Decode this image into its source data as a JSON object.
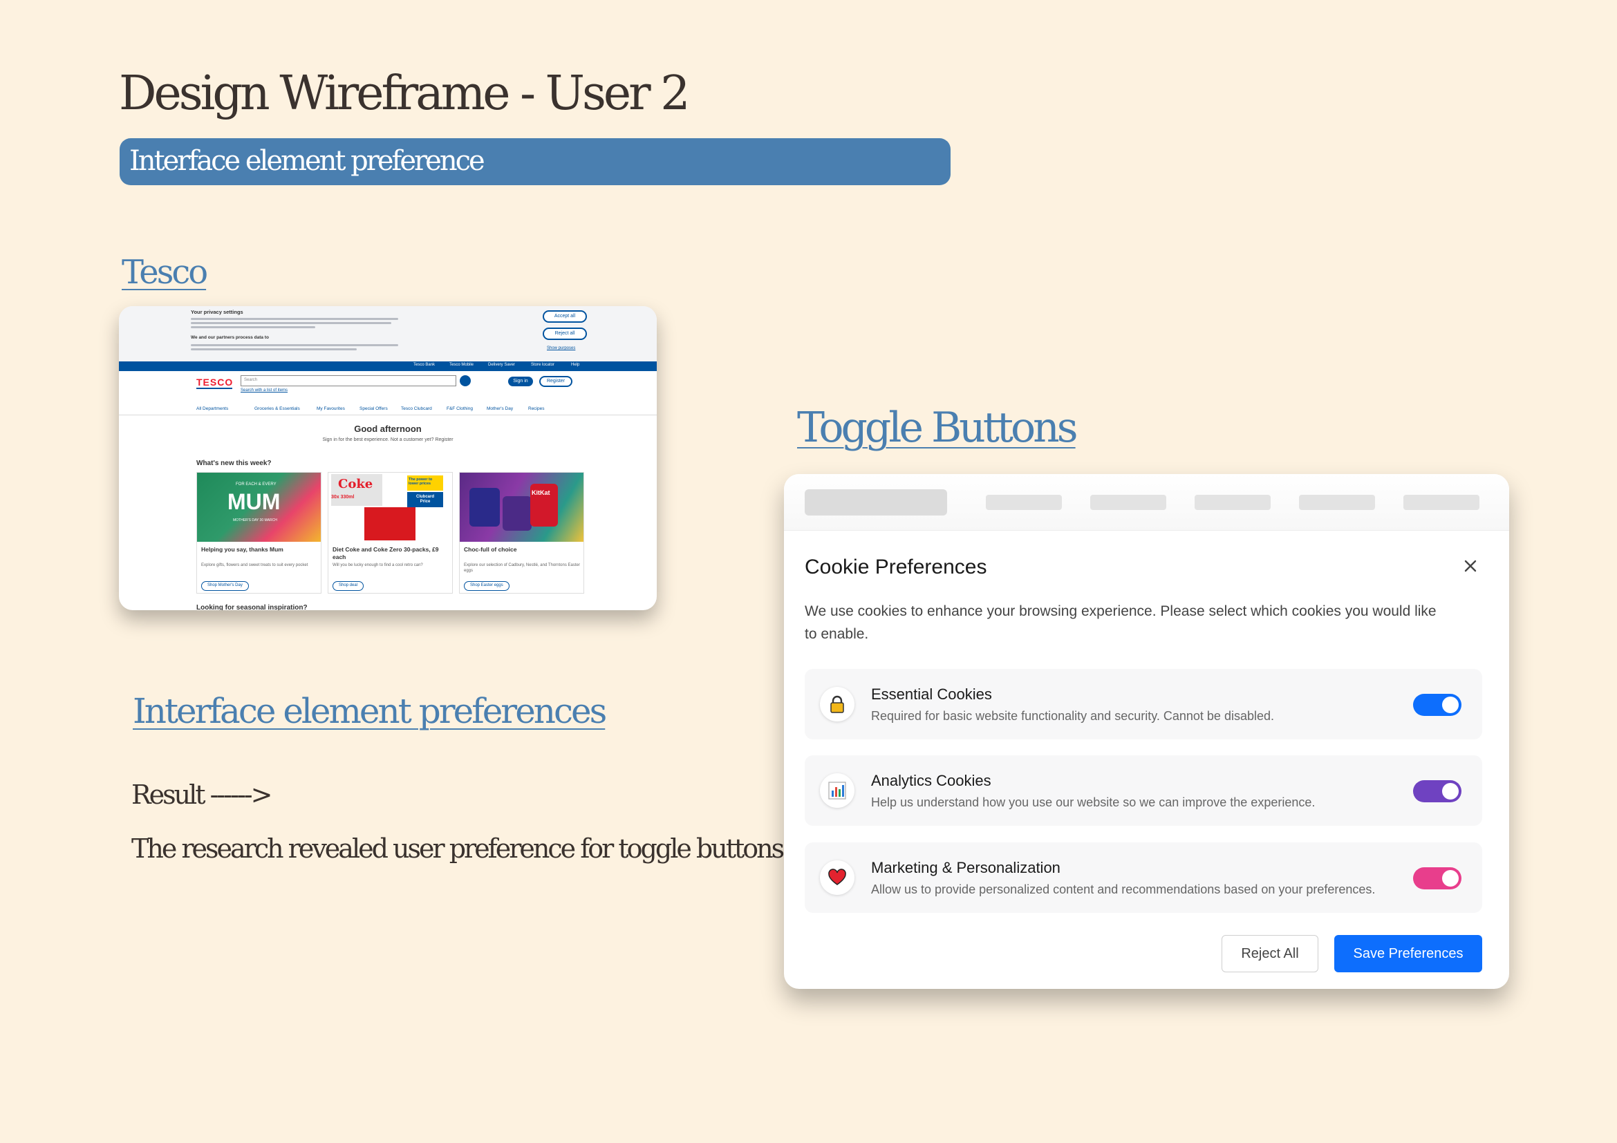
{
  "page": {
    "title": "Design Wireframe - User 2",
    "subtitle": "Interface element preference",
    "tesco_heading": "Tesco",
    "toggle_heading": "Toggle Buttons",
    "iep_heading": "Interface element preferences",
    "result_text": "Result ------>",
    "research_text": "The research revealed user preference for toggle buttons"
  },
  "tesco": {
    "privacy_title": "Your privacy settings",
    "privacy_sub": "We and our partners process data to",
    "privacy_link": "Show purposes",
    "accept_all": "Accept all",
    "reject_all": "Reject all",
    "top_links": [
      "Tesco Bank",
      "Tesco Mobile",
      "Delivery Saver",
      "Store locator",
      "Help"
    ],
    "logo": "TESCO",
    "search_placeholder": "Search",
    "search_list_link": "Search with a list of items",
    "sign_in": "Sign in",
    "register": "Register",
    "nav": [
      "All Departments",
      "Groceries & Essentials",
      "My Favourites",
      "Special Offers",
      "Tesco Clubcard",
      "F&F Clothing",
      "Mother's Day",
      "Recipes"
    ],
    "greeting": "Good afternoon",
    "greeting_sub": "Sign in for the best experience. Not a customer yet? Register",
    "section_title": "What's new this week?",
    "tiles": [
      {
        "title": "Helping you say, thanks Mum",
        "desc": "Explore gifts, flowers and sweet treats to suit every pocket",
        "button": "Shop Mother's Day",
        "banner": "MUM",
        "banner_small": "FOR EACH & EVERY",
        "banner_date": "MOTHER'S DAY 30 MARCH"
      },
      {
        "title": "Diet Coke and Coke Zero 30-packs, £9 each",
        "desc": "Will you be lucky enough to find a cool retro can?",
        "button": "Shop deal",
        "banner": "Coke",
        "badge": "The power to lower prices",
        "badge2": "Clubcard Price",
        "size": "30x 330ml"
      },
      {
        "title": "Choc-full of choice",
        "desc": "Explore our selection of Cadbury, Nestlé, and Thorntons Easter eggs",
        "button": "Shop Easter eggs",
        "banner": "KitKat"
      }
    ],
    "more_title": "Looking for seasonal inspiration?",
    "colors": {
      "blue": "#00539f",
      "red": "#ee1c2e"
    }
  },
  "cookie": {
    "title": "Cookie Preferences",
    "description": "We use cookies to enhance your browsing experience. Please select which cookies you would like to enable.",
    "rows": [
      {
        "title": "Essential Cookies",
        "desc": "Required for basic website functionality and security. Cannot be disabled.",
        "icon": "lock-icon",
        "enabled": true,
        "color": "#0d6efd"
      },
      {
        "title": "Analytics Cookies",
        "desc": "Help us understand how you use our website so we can improve the experience.",
        "icon": "bar-chart-icon",
        "enabled": true,
        "color": "#6f42c1"
      },
      {
        "title": "Marketing & Personalization",
        "desc": "Allow us to provide personalized content and recommendations based on your preferences.",
        "icon": "heart-icon",
        "enabled": true,
        "color": "#e83e8c"
      }
    ],
    "reject_label": "Reject All",
    "save_label": "Save Preferences"
  },
  "colors": {
    "background": "#fdf2e0",
    "accent": "#4a7fb0"
  }
}
